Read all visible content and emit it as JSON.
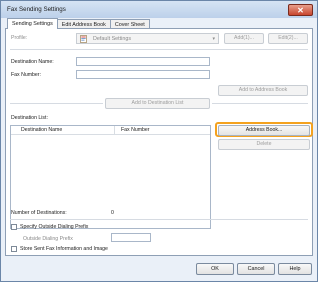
{
  "window": {
    "title": "Fax Sending Settings"
  },
  "tabs": [
    {
      "label": "Sending Settings",
      "active": true
    },
    {
      "label": "Edit Address Book",
      "active": false
    },
    {
      "label": "Cover Sheet",
      "active": false
    }
  ],
  "profile": {
    "label": "Profile:",
    "value": "Default Settings",
    "add_label": "Add(1)...",
    "edit_label": "Edit(2)..."
  },
  "destination": {
    "name_label": "Destination Name:",
    "name_value": "",
    "fax_label": "Fax Number:",
    "fax_value": "",
    "add_to_address_book_label": "Add to Address Book",
    "add_to_list_label": "Add to Destination List"
  },
  "destination_list": {
    "label": "Destination List:",
    "columns": [
      "Destination Name",
      "Fax Number"
    ],
    "rows": [],
    "address_book_label": "Address Book...",
    "delete_label": "Delete"
  },
  "summary": {
    "count_label": "Number of Destinations:",
    "count_value": "0"
  },
  "options": {
    "outside_prefix_label": "Specify Outside Dialing Prefix",
    "outside_prefix_checked": false,
    "outside_prefix_field_label": "Outside Dialing Prefix",
    "outside_prefix_value": "",
    "store_sent_label": "Store Sent Fax Information and Image",
    "store_sent_checked": false
  },
  "footer": {
    "ok_label": "OK",
    "cancel_label": "Cancel",
    "help_label": "Help"
  },
  "colors": {
    "highlight": "#f4a21f",
    "close_button": "#c8452e"
  }
}
